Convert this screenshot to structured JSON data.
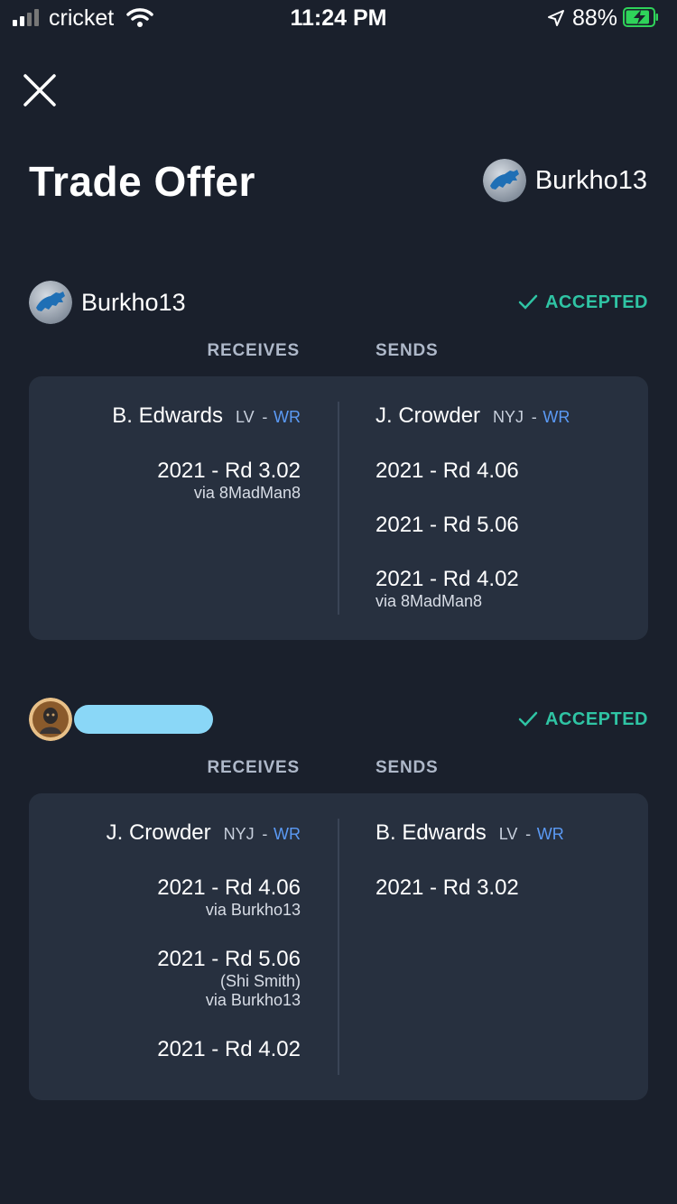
{
  "status_bar": {
    "carrier": "cricket",
    "time": "11:24 PM",
    "battery_percent": "88%",
    "battery_level": 0.88
  },
  "header": {
    "title": "Trade Offer",
    "user": "Burkho13"
  },
  "labels": {
    "receives": "RECEIVES",
    "sends": "SENDS",
    "accepted": "ACCEPTED"
  },
  "party1": {
    "name": "Burkho13",
    "receives": {
      "player": {
        "name": "B. Edwards",
        "team": "LV",
        "sep": "-",
        "pos": "WR"
      },
      "picks": [
        {
          "label": "2021 - Rd 3.02",
          "via": "via 8MadMan8"
        }
      ]
    },
    "sends": {
      "player": {
        "name": "J. Crowder",
        "team": "NYJ",
        "sep": "-",
        "pos": "WR"
      },
      "picks": [
        {
          "label": "2021 - Rd 4.06"
        },
        {
          "label": "2021 - Rd 5.06"
        },
        {
          "label": "2021 - Rd 4.02",
          "via": "via 8MadMan8"
        }
      ]
    }
  },
  "party2": {
    "receives": {
      "player": {
        "name": "J. Crowder",
        "team": "NYJ",
        "sep": "-",
        "pos": "WR"
      },
      "picks": [
        {
          "label": "2021 - Rd 4.06",
          "via": "via Burkho13"
        },
        {
          "label": "2021 - Rd 5.06",
          "note": "(Shi Smith)",
          "via": "via Burkho13"
        },
        {
          "label": "2021 - Rd 4.02"
        }
      ]
    },
    "sends": {
      "player": {
        "name": "B. Edwards",
        "team": "LV",
        "sep": "-",
        "pos": "WR"
      },
      "picks": [
        {
          "label": "2021 - Rd 3.02"
        }
      ]
    }
  },
  "colors": {
    "background": "#1a202c",
    "card": "#27303f",
    "accent_green": "#2fc4a4",
    "position_blue": "#5b9af5"
  }
}
